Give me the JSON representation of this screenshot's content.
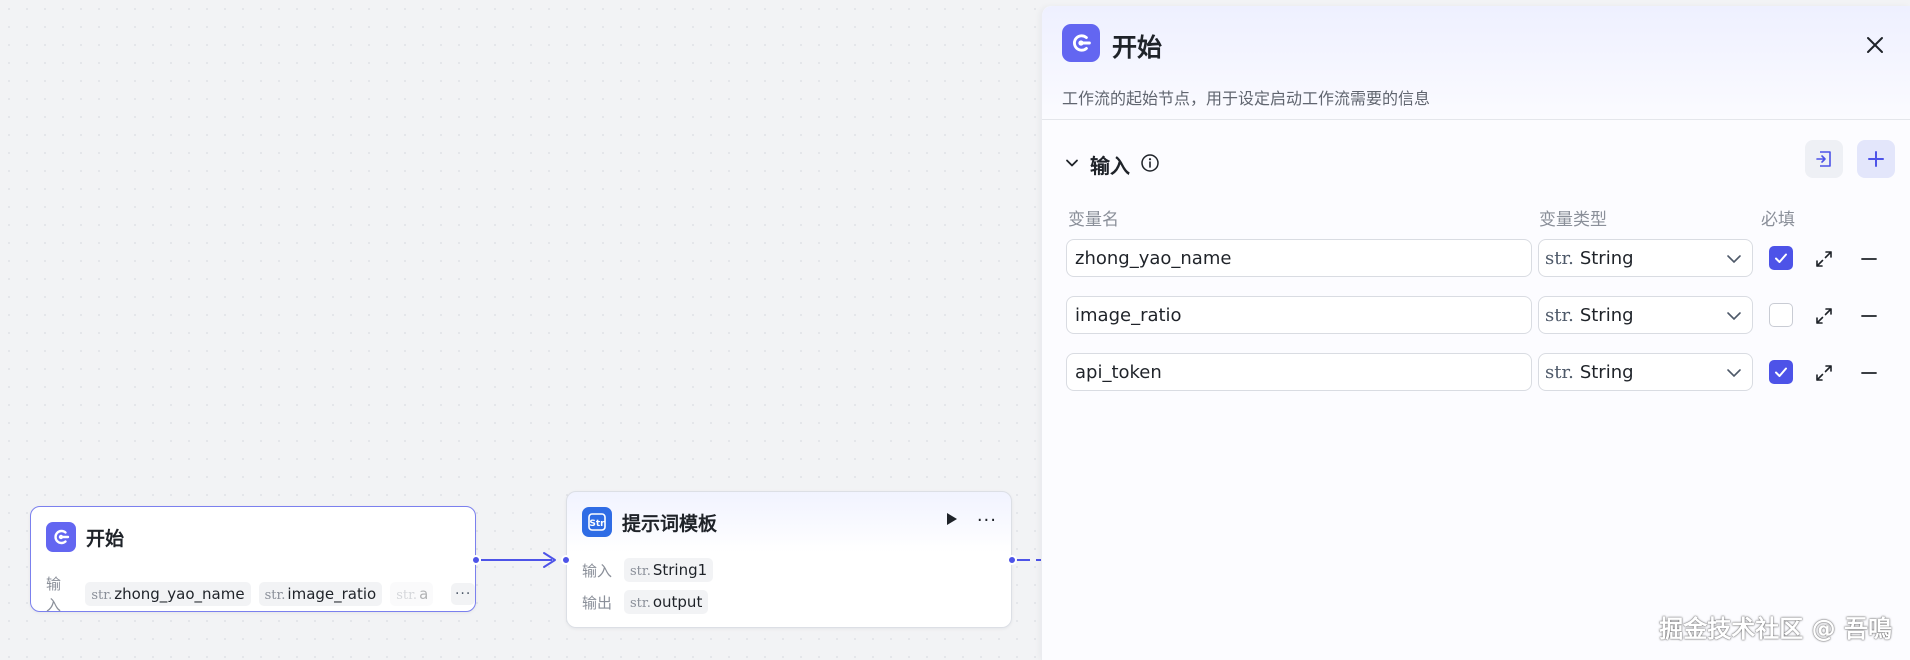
{
  "canvas": {
    "start_node": {
      "title": "开始",
      "input_label": "输入",
      "params": [
        {
          "type": "str.",
          "name": "zhong_yao_name"
        },
        {
          "type": "str.",
          "name": "image_ratio"
        },
        {
          "type": "str.",
          "name": "a"
        }
      ],
      "more": "···"
    },
    "template_node": {
      "title": "提示词模板",
      "input_label": "输入",
      "output_label": "输出",
      "input_param": {
        "type": "str.",
        "name": "String1"
      },
      "output_param": {
        "type": "str.",
        "name": "output"
      },
      "more": "···"
    }
  },
  "panel": {
    "title": "开始",
    "description": "工作流的起始节点，用于设定启动工作流需要的信息",
    "section_title": "输入",
    "columns": {
      "name": "变量名",
      "type": "变量类型",
      "required": "必填"
    },
    "variables": [
      {
        "name": "zhong_yao_name",
        "type_prefix": "str.",
        "type": "String",
        "required": true
      },
      {
        "name": "image_ratio",
        "type_prefix": "str.",
        "type": "String",
        "required": false
      },
      {
        "name": "api_token",
        "type_prefix": "str.",
        "type": "String",
        "required": true
      }
    ]
  },
  "watermark": "掘金技术社区 @ 吾鳴",
  "colors": {
    "accent": "#4d53e8",
    "start_icon": "#6366f1",
    "template_icon": "#2f6ce5"
  }
}
